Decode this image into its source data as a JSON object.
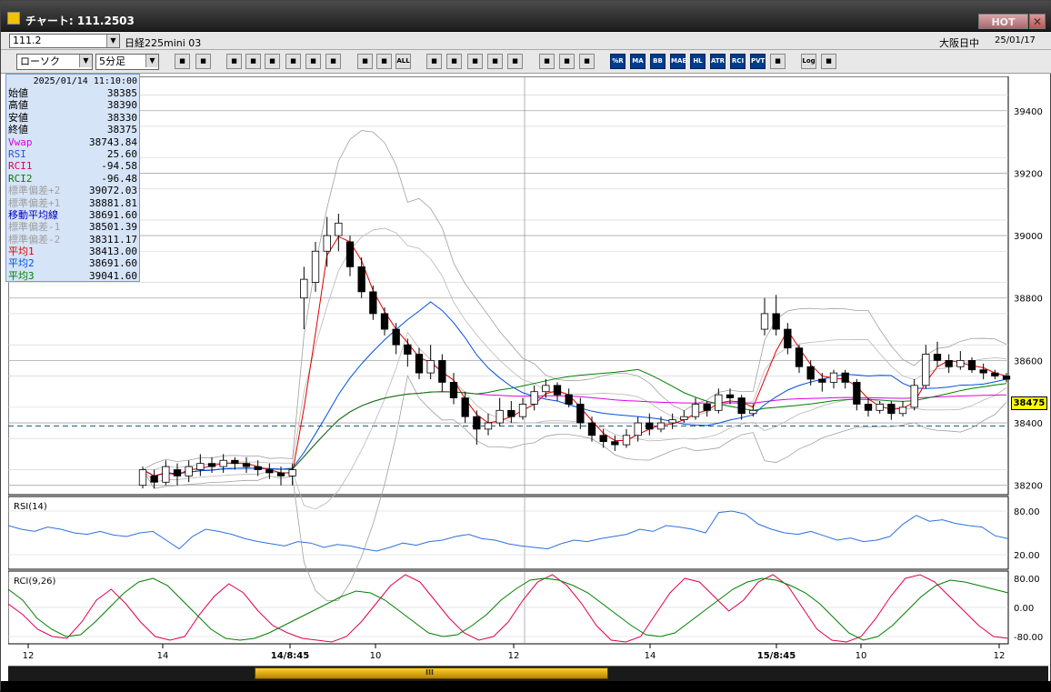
{
  "window": {
    "title": "チャート: 111.2503",
    "hot": "HOT",
    "close": "✕"
  },
  "symbol_bar": {
    "code": "111.2",
    "name": "日経225mini 03",
    "market": "大阪日中",
    "date": "25/01/17"
  },
  "toolbar": {
    "chart_type": "ローソク",
    "interval": "5分足",
    "buttons": [
      "zoom-icon",
      "window-icon",
      "pen-icon",
      "reset-icon",
      "cursor-icon",
      "undo-icon",
      "page-icon",
      "trash-icon",
      "candle-icon",
      "candle2-icon",
      "ALL",
      "down-icon",
      "search-icon",
      "chart-icon",
      "flag-icon",
      "circle-icon",
      "gear-icon",
      "brush-icon",
      "palette-icon",
      "%R",
      "MA",
      "BB",
      "MAE",
      "HL",
      "ATR",
      "RCI",
      "PVT",
      "box-icon",
      "Log",
      "exit-icon"
    ]
  },
  "info": {
    "timestamp": "2025/01/14  11:10:00",
    "rows": [
      {
        "label": "始値",
        "value": "38385",
        "color": "#000000"
      },
      {
        "label": "高値",
        "value": "38390",
        "color": "#000000"
      },
      {
        "label": "安値",
        "value": "38330",
        "color": "#000000"
      },
      {
        "label": "終値",
        "value": "38375",
        "color": "#000000"
      },
      {
        "label": "Vwap",
        "value": "38743.84",
        "color": "#e000e0"
      },
      {
        "label": "RSI",
        "value": "25.60",
        "color": "#3050e0"
      },
      {
        "label": "RCI1",
        "value": "-94.58",
        "color": "#e00050"
      },
      {
        "label": "RCI2",
        "value": "-96.48",
        "color": "#008000"
      },
      {
        "label": "標準偏差+2",
        "value": "39072.03",
        "color": "#a0a0a0"
      },
      {
        "label": "標準偏差+1",
        "value": "38881.81",
        "color": "#a0a0a0"
      },
      {
        "label": "移動平均線",
        "value": "38691.60",
        "color": "#0000c0"
      },
      {
        "label": "標準偏差-1",
        "value": "38501.39",
        "color": "#a0a0a0"
      },
      {
        "label": "標準偏差-2",
        "value": "38311.17",
        "color": "#a0a0a0"
      },
      {
        "label": "平均1",
        "value": "38413.00",
        "color": "#e00000"
      },
      {
        "label": "平均2",
        "value": "38691.60",
        "color": "#0050e0"
      },
      {
        "label": "平均3",
        "value": "39041.60",
        "color": "#008000"
      }
    ]
  },
  "current_price": "38475",
  "rsi_label": "RSI(14)",
  "rci_label": "RCI(9,26)",
  "chart_data": [
    {
      "type": "line",
      "price_axis": {
        "ticks": [
          39400,
          39200,
          39000,
          38800,
          38600,
          38400,
          38200
        ],
        "range": [
          38170,
          39510
        ]
      },
      "x_labels": [
        "12",
        "14",
        "14/8:45",
        "10",
        "12",
        "14",
        "15/8:45",
        "10",
        "12"
      ],
      "candles": [
        [
          38200,
          38250,
          38190,
          38260
        ],
        [
          38230,
          38210,
          38190,
          38250
        ],
        [
          38210,
          38260,
          38200,
          38280
        ],
        [
          38250,
          38230,
          38200,
          38270
        ],
        [
          38230,
          38260,
          38210,
          38280
        ],
        [
          38250,
          38270,
          38230,
          38300
        ],
        [
          38270,
          38260,
          38240,
          38290
        ],
        [
          38260,
          38280,
          38240,
          38300
        ],
        [
          38280,
          38270,
          38250,
          38290
        ],
        [
          38270,
          38260,
          38240,
          38290
        ],
        [
          38260,
          38250,
          38230,
          38280
        ],
        [
          38250,
          38240,
          38220,
          38270
        ],
        [
          38240,
          38230,
          38200,
          38260
        ],
        [
          38230,
          38250,
          38200,
          38270
        ],
        [
          38800,
          38860,
          38700,
          38900
        ],
        [
          38850,
          38950,
          38820,
          38980
        ],
        [
          38950,
          39000,
          38900,
          39060
        ],
        [
          39000,
          39040,
          38950,
          39070
        ],
        [
          38980,
          38900,
          38870,
          39000
        ],
        [
          38900,
          38820,
          38800,
          38930
        ],
        [
          38820,
          38750,
          38730,
          38840
        ],
        [
          38750,
          38700,
          38680,
          38770
        ],
        [
          38700,
          38650,
          38620,
          38720
        ],
        [
          38650,
          38620,
          38580,
          38670
        ],
        [
          38620,
          38560,
          38540,
          38640
        ],
        [
          38560,
          38600,
          38540,
          38650
        ],
        [
          38600,
          38530,
          38500,
          38620
        ],
        [
          38530,
          38480,
          38460,
          38560
        ],
        [
          38480,
          38420,
          38400,
          38500
        ],
        [
          38420,
          38380,
          38330,
          38440
        ],
        [
          38380,
          38400,
          38360,
          38430
        ],
        [
          38400,
          38440,
          38390,
          38480
        ],
        [
          38440,
          38420,
          38400,
          38470
        ],
        [
          38420,
          38460,
          38410,
          38480
        ],
        [
          38460,
          38500,
          38440,
          38520
        ],
        [
          38500,
          38520,
          38480,
          38540
        ],
        [
          38520,
          38490,
          38470,
          38530
        ],
        [
          38490,
          38460,
          38450,
          38510
        ],
        [
          38460,
          38400,
          38380,
          38480
        ],
        [
          38400,
          38360,
          38340,
          38420
        ],
        [
          38360,
          38340,
          38320,
          38380
        ],
        [
          38340,
          38330,
          38310,
          38360
        ],
        [
          38330,
          38360,
          38320,
          38380
        ],
        [
          38360,
          38400,
          38340,
          38420
        ],
        [
          38400,
          38380,
          38360,
          38430
        ],
        [
          38380,
          38400,
          38370,
          38420
        ],
        [
          38400,
          38410,
          38380,
          38430
        ],
        [
          38410,
          38420,
          38400,
          38440
        ],
        [
          38420,
          38460,
          38410,
          38480
        ],
        [
          38460,
          38440,
          38420,
          38470
        ],
        [
          38440,
          38490,
          38430,
          38510
        ],
        [
          38490,
          38480,
          38460,
          38510
        ],
        [
          38480,
          38430,
          38410,
          38490
        ],
        [
          38430,
          38440,
          38420,
          38460
        ],
        [
          38700,
          38750,
          38680,
          38800
        ],
        [
          38750,
          38700,
          38680,
          38810
        ],
        [
          38700,
          38640,
          38620,
          38720
        ],
        [
          38640,
          38580,
          38560,
          38650
        ],
        [
          38580,
          38540,
          38520,
          38600
        ],
        [
          38540,
          38530,
          38500,
          38560
        ],
        [
          38530,
          38560,
          38510,
          38570
        ],
        [
          38560,
          38530,
          38510,
          38570
        ],
        [
          38530,
          38460,
          38440,
          38540
        ],
        [
          38460,
          38440,
          38420,
          38480
        ],
        [
          38440,
          38460,
          38430,
          38470
        ],
        [
          38460,
          38430,
          38410,
          38470
        ],
        [
          38430,
          38450,
          38420,
          38470
        ],
        [
          38450,
          38520,
          38440,
          38540
        ],
        [
          38520,
          38620,
          38510,
          38650
        ],
        [
          38620,
          38600,
          38580,
          38660
        ],
        [
          38600,
          38580,
          38560,
          38620
        ],
        [
          38580,
          38600,
          38570,
          38630
        ],
        [
          38600,
          38570,
          38560,
          38610
        ],
        [
          38570,
          38560,
          38540,
          38590
        ],
        [
          38560,
          38550,
          38540,
          38570
        ],
        [
          38550,
          38540,
          38530,
          38560
        ]
      ]
    },
    {
      "type": "line",
      "name": "RSI",
      "ticks": [
        80,
        20
      ],
      "values": [
        60,
        55,
        52,
        58,
        55,
        50,
        48,
        52,
        47,
        45,
        50,
        52,
        40,
        28,
        45,
        55,
        52,
        48,
        42,
        38,
        35,
        32,
        38,
        36,
        30,
        34,
        32,
        28,
        25,
        30,
        36,
        33,
        38,
        40,
        45,
        48,
        42,
        40,
        35,
        32,
        30,
        28,
        35,
        40,
        38,
        42,
        45,
        48,
        55,
        52,
        60,
        58,
        55,
        50,
        78,
        80,
        76,
        62,
        55,
        50,
        48,
        52,
        46,
        40,
        43,
        38,
        40,
        45,
        62,
        74,
        66,
        68,
        63,
        60,
        58,
        46,
        42
      ]
    },
    {
      "type": "line",
      "name": "RCI",
      "ticks": [
        80,
        0,
        -80
      ],
      "rci1": [
        10,
        -20,
        -60,
        -80,
        -85,
        -40,
        20,
        50,
        10,
        -40,
        -80,
        -90,
        -80,
        -20,
        30,
        65,
        40,
        -10,
        -50,
        -70,
        -85,
        -90,
        -95,
        -80,
        -40,
        10,
        60,
        90,
        70,
        20,
        -30,
        -70,
        -90,
        -80,
        -40,
        20,
        70,
        90,
        60,
        10,
        -50,
        -90,
        -95,
        -80,
        -20,
        40,
        80,
        70,
        30,
        -10,
        20,
        70,
        90,
        60,
        0,
        -60,
        -90,
        -95,
        -80,
        -30,
        30,
        80,
        90,
        70,
        30,
        -10,
        -50,
        -80,
        -85
      ],
      "rci2": [
        50,
        20,
        -30,
        -60,
        -80,
        -75,
        -40,
        0,
        40,
        70,
        80,
        60,
        20,
        -20,
        -60,
        -85,
        -90,
        -85,
        -70,
        -50,
        -30,
        -10,
        10,
        30,
        45,
        40,
        20,
        -10,
        -40,
        -70,
        -80,
        -75,
        -50,
        -20,
        20,
        50,
        75,
        80,
        75,
        60,
        40,
        10,
        -20,
        -50,
        -75,
        -80,
        -70,
        -40,
        -10,
        20,
        50,
        70,
        80,
        75,
        60,
        40,
        10,
        -30,
        -70,
        -90,
        -80,
        -50,
        -10,
        30,
        60,
        75,
        70,
        60,
        50,
        40
      ]
    }
  ]
}
